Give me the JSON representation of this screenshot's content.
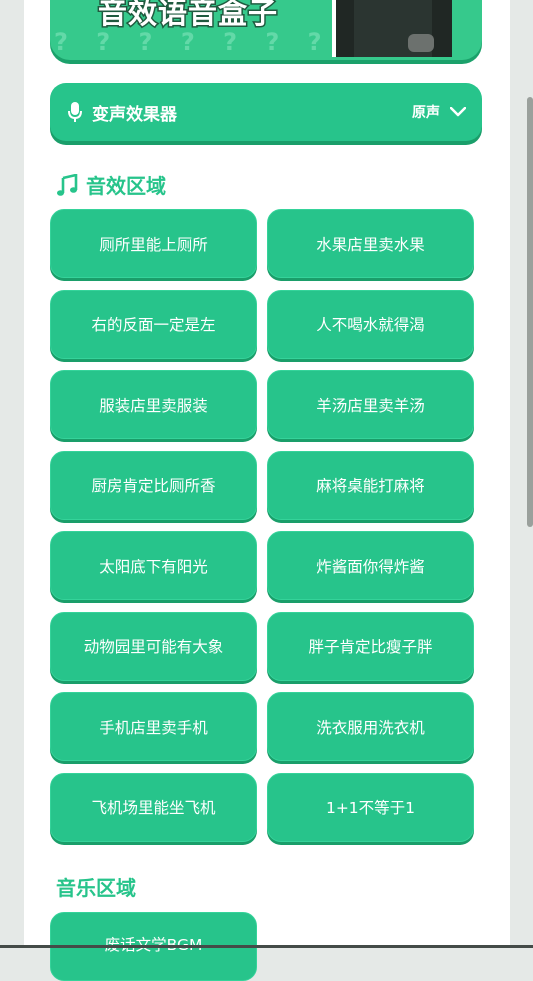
{
  "banner": {
    "title": "音效语音盒子",
    "pattern": "? ? ? ? ? ? ? ? ?"
  },
  "voice_changer": {
    "title": "变声效果器",
    "value": "原声"
  },
  "sound_section": {
    "title": "音效区域",
    "buttons": [
      "厕所里能上厕所",
      "水果店里卖水果",
      "右的反面一定是左",
      "人不喝水就得渴",
      "服装店里卖服装",
      "羊汤店里卖羊汤",
      "厨房肯定比厕所香",
      "麻将桌能打麻将",
      "太阳底下有阳光",
      "炸酱面你得炸酱",
      "动物园里可能有大象",
      "胖子肯定比瘦子胖",
      "手机店里卖手机",
      "洗衣服用洗衣机",
      "飞机场里能坐飞机",
      "1+1不等于1"
    ]
  },
  "music_section": {
    "title": "音乐区域",
    "buttons": [
      "废话文学BGM"
    ]
  },
  "colors": {
    "accent": "#27c48b",
    "accent_shadow": "#1a9e6a",
    "page_bg": "#e5e9e7"
  }
}
